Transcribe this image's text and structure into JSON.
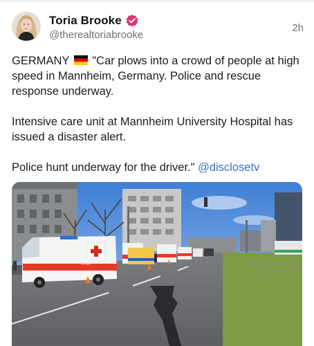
{
  "post": {
    "author": {
      "display_name": "Toria Brooke",
      "handle": "@therealtoriabrooke",
      "verified_icon": "verified-badge-icon",
      "verified_color": "#e0356e"
    },
    "timestamp": "2h",
    "paragraph1_prefix": "GERMANY",
    "flag_icon": "germany-flag-icon",
    "paragraph1_text": " \"Car plows into a crowd of people at high speed in Mannheim, Germany. Police and rescue response underway.",
    "paragraph2": "Intensive care unit at Mannheim University Hospital has issued a disaster alert.",
    "paragraph3_text": "Police hunt underway for the driver.\" ",
    "mention": "@disclosetv",
    "mention_color": "#3d6fc4",
    "media": {
      "ambulance_label": "RTW"
    }
  }
}
